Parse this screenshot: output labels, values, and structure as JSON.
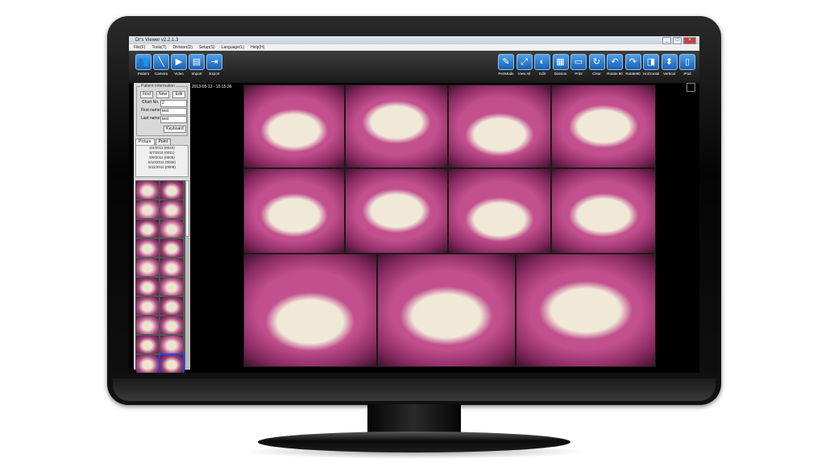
{
  "window": {
    "title": "Dr's Viewer v2.2.1.3",
    "min": "_",
    "max": "□",
    "close": "×"
  },
  "menu": [
    "File(F)",
    "Tools(T)",
    "Division(D)",
    "Setup(S)",
    "Language(L)",
    "Help(H)"
  ],
  "toolbar_left": [
    {
      "label": "Patient",
      "icon": "patient-icon",
      "glyph": "👥"
    },
    {
      "label": "Camera",
      "icon": "camera-icon",
      "glyph": "╲"
    },
    {
      "label": "Video",
      "icon": "video-icon",
      "glyph": "▶"
    },
    {
      "label": "Import",
      "icon": "import-icon",
      "glyph": "▤"
    },
    {
      "label": "Export",
      "icon": "export-icon",
      "glyph": "⇥"
    }
  ],
  "toolbar_right": [
    {
      "label": "PenMode",
      "icon": "pen-icon",
      "glyph": "✎"
    },
    {
      "label": "View All",
      "icon": "view-all-icon",
      "glyph": "⤢"
    },
    {
      "label": "Edit",
      "icon": "edit-icon",
      "glyph": "◐"
    },
    {
      "label": "Division",
      "icon": "division-icon",
      "glyph": "▦"
    },
    {
      "label": "Print",
      "icon": "print-icon",
      "glyph": "▭"
    },
    {
      "label": "Clear",
      "icon": "clear-icon",
      "glyph": "↻"
    },
    {
      "label": "Rotate 90",
      "icon": "rotate-left-icon",
      "glyph": "↶"
    },
    {
      "label": "Rotate90",
      "icon": "rotate-right-icon",
      "glyph": "↷"
    },
    {
      "label": "Horizontal",
      "icon": "horizontal-flip-icon",
      "glyph": "◨"
    },
    {
      "label": "Vertical",
      "icon": "vertical-flip-icon",
      "glyph": "⬍"
    },
    {
      "label": "iPad",
      "icon": "ipad-icon",
      "glyph": "▯"
    }
  ],
  "patient": {
    "section_title": "Patient Information",
    "find": "Find",
    "new": "New",
    "edit": "Edit",
    "chart_label": "Chart No.",
    "chart_value": "2",
    "first_label": "First name",
    "first_value": "test",
    "last_label": "Last name",
    "last_value": "test",
    "keyboard": "Keyboard"
  },
  "tabs": [
    "Picture",
    "Point"
  ],
  "dates": [
    "4/4/2011 (0019)",
    "5/7/2011 (0011)",
    "5/9/2011 (0005)",
    "5/10/2011 (0005)",
    "5/11/2011 (0009)"
  ],
  "timestamp": "2013-05-13 - 15:15:36",
  "colors": {
    "toolbar_icon": "#2a78d2",
    "tissue": "#b0407a",
    "tooth": "#e6dcc8",
    "selection": "#1e44ff"
  }
}
